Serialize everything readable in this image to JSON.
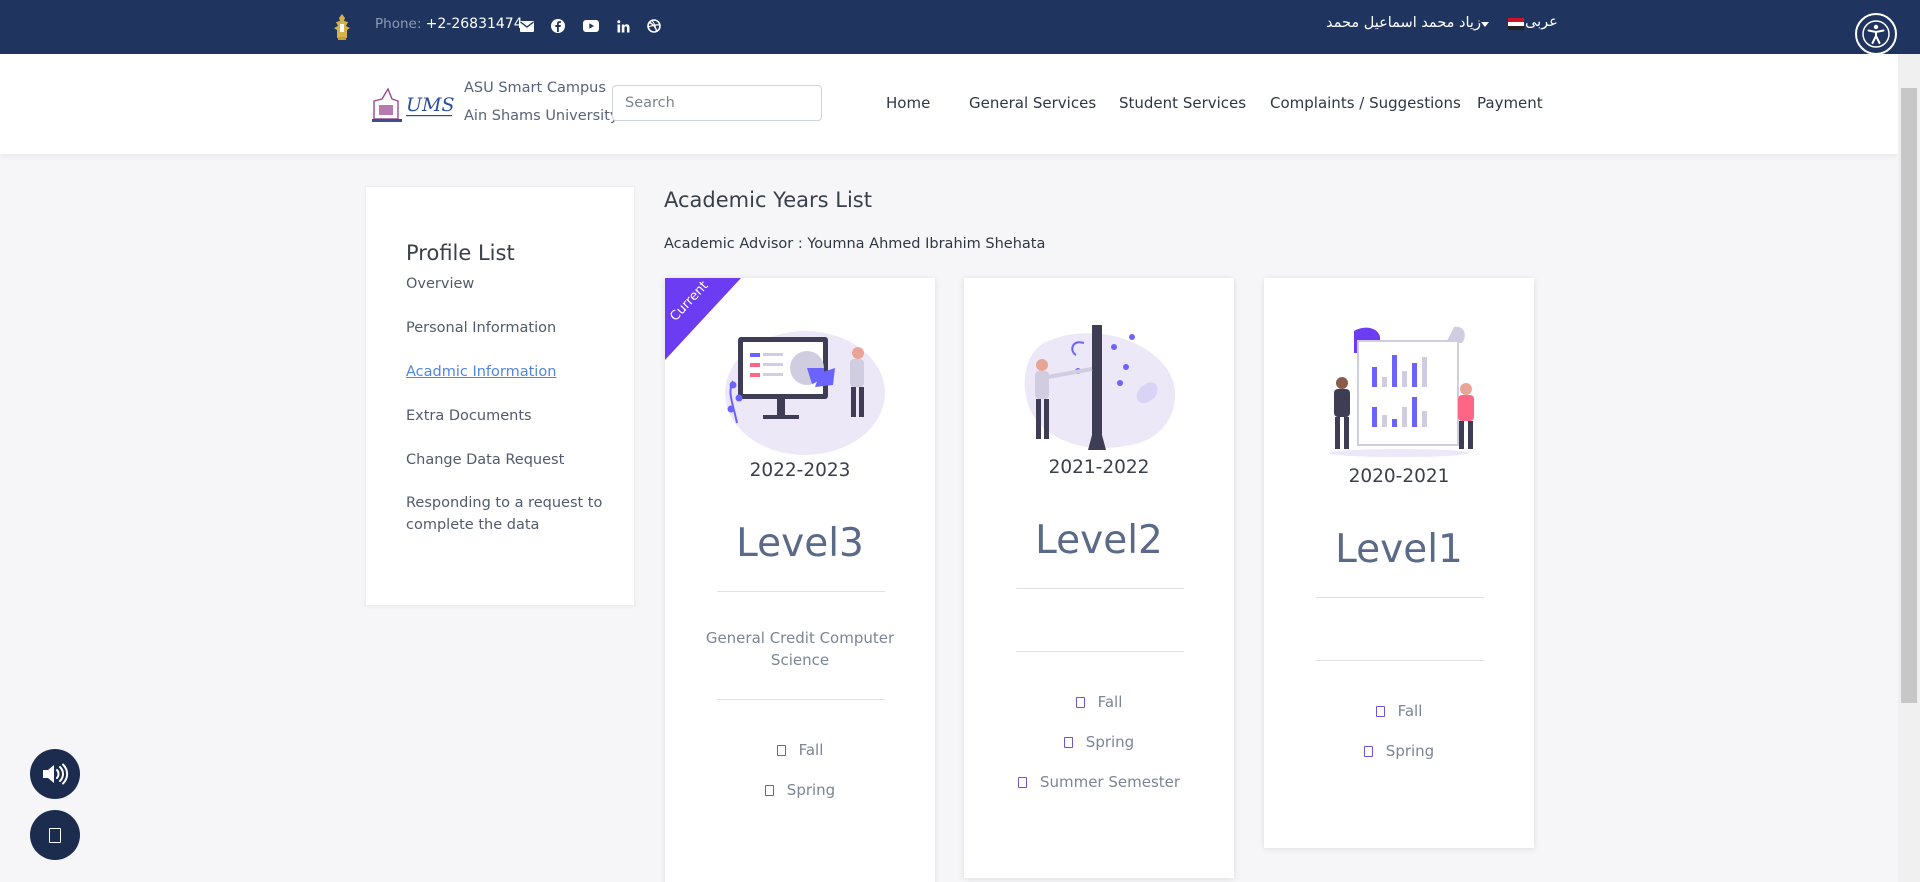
{
  "topbar": {
    "phone_label": "Phone:",
    "phone_number": "+2-26831474",
    "user_name": "زياد محمد اسماعيل محمد",
    "language": "عربى",
    "social_icons": [
      "mail-icon",
      "facebook-icon",
      "youtube-icon",
      "linkedin-icon",
      "dribbble-icon"
    ]
  },
  "navbar": {
    "brand_line1": "ASU Smart Campus",
    "brand_line2": "Ain Shams University.",
    "logo_text": "UMS",
    "search_placeholder": "Search",
    "links": [
      "Home",
      "General Services",
      "Student Services",
      "Complaints / Suggestions",
      "Payment"
    ]
  },
  "sidebar": {
    "title": "Profile List",
    "items": [
      "Overview",
      "Personal Information",
      "Acadmic Information",
      "Extra Documents",
      "Change Data Request",
      "Responding to a request to complete the data"
    ],
    "active_index": 2
  },
  "main": {
    "title": "Academic Years List",
    "advisor": "Academic Advisor : Youmna Ahmed Ibrahim Shehata"
  },
  "cards": [
    {
      "ribbon": "Current",
      "year": "2022-2023",
      "level": "Level3",
      "program": "General Credit Computer Science",
      "terms": [
        "Fall",
        "Spring"
      ]
    },
    {
      "year": "2021-2022",
      "level": "Level2",
      "program": "",
      "terms": [
        "Fall",
        "Spring",
        "Summer Semester"
      ]
    },
    {
      "year": "2020-2021",
      "level": "Level1",
      "program": "",
      "terms": [
        "Fall",
        "Spring"
      ]
    }
  ],
  "colors": {
    "topbar": "#1f3560",
    "accent": "#6c3cf2",
    "link_active": "#4f86df",
    "level_text": "#5b6a88"
  },
  "floating": [
    "volume-icon",
    "checkbox-icon"
  ]
}
